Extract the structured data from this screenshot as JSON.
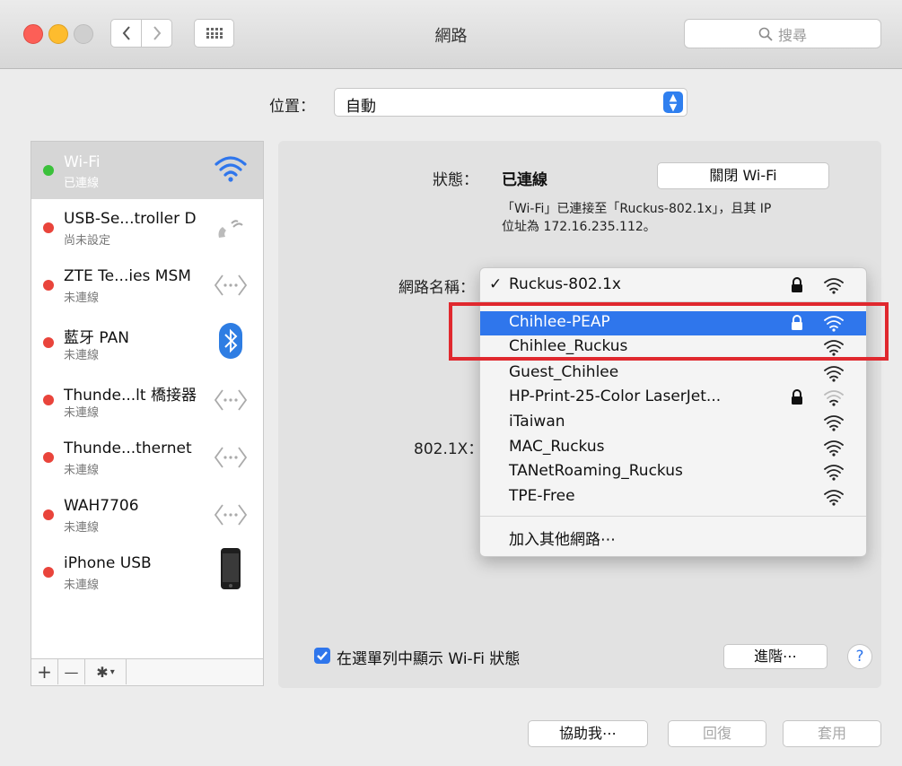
{
  "window": {
    "title": "網路",
    "search_placeholder": "搜尋"
  },
  "location": {
    "label": "位置：",
    "value": "自動"
  },
  "services": [
    {
      "name": "Wi-Fi",
      "status": "已連線",
      "state": "connected",
      "icon": "wifi-icon"
    },
    {
      "name": "USB-Se...troller D",
      "status": "尚未設定",
      "state": "off",
      "icon": "phone-modem-icon"
    },
    {
      "name": "ZTE Te...ies MSM",
      "status": "未連線",
      "state": "off",
      "icon": "ethernet-arrows-icon"
    },
    {
      "name": "藍牙 PAN",
      "status": "未連線",
      "state": "off",
      "icon": "bluetooth-icon"
    },
    {
      "name": "Thunde...lt 橋接器",
      "status": "未連線",
      "state": "off",
      "icon": "ethernet-arrows-icon"
    },
    {
      "name": "Thunde...thernet",
      "status": "未連線",
      "state": "off",
      "icon": "ethernet-arrows-icon"
    },
    {
      "name": "WAH7706",
      "status": "未連線",
      "state": "off",
      "icon": "ethernet-arrows-icon"
    },
    {
      "name": "iPhone USB",
      "status": "未連線",
      "state": "off",
      "icon": "iphone-icon"
    }
  ],
  "sidebar_buttons": {
    "add": "+",
    "remove": "—"
  },
  "detail": {
    "status_label": "狀態：",
    "status_value": "已連線",
    "toggle_button": "關閉 Wi-Fi",
    "description_line1": "「Wi-Fi」已連接至「Ruckus-802.1x」，且其 IP",
    "description_line2": "位址為 172.16.235.112。",
    "network_name_label": "網路名稱：",
    "dot1x_label": "802.1X：",
    "show_status_checkbox": "在選單列中顯示 Wi-Fi 狀態",
    "show_status_checked": true,
    "advanced_button": "進階⋯",
    "help_button": "?"
  },
  "network_menu": {
    "items": [
      {
        "name": "Ruckus-802.1x",
        "checked": true,
        "locked": true,
        "highlighted": false
      },
      {
        "name": "Chihlee-PEAP",
        "checked": false,
        "locked": true,
        "highlighted": true
      },
      {
        "name": "Chihlee_Ruckus",
        "checked": false,
        "locked": false,
        "highlighted": false
      },
      {
        "name": "Guest_Chihlee",
        "checked": false,
        "locked": false,
        "highlighted": false
      },
      {
        "name": "HP-Print-25-Color LaserJet...",
        "checked": false,
        "locked": true,
        "highlighted": false
      },
      {
        "name": "iTaiwan",
        "checked": false,
        "locked": false,
        "highlighted": false
      },
      {
        "name": "MAC_Ruckus",
        "checked": false,
        "locked": false,
        "highlighted": false
      },
      {
        "name": "TANetRoaming_Ruckus",
        "checked": false,
        "locked": false,
        "highlighted": false
      },
      {
        "name": "TPE-Free",
        "checked": false,
        "locked": false,
        "highlighted": false
      }
    ],
    "join_other": "加入其他網路⋯",
    "checkmark": "✓"
  },
  "footer": {
    "assist": "協助我⋯",
    "revert": "回復",
    "apply": "套用"
  },
  "colors": {
    "accent": "#2f76ec",
    "connected": "#3bc13b",
    "disconnected": "#e9443b",
    "annotation": "#e0282e"
  }
}
